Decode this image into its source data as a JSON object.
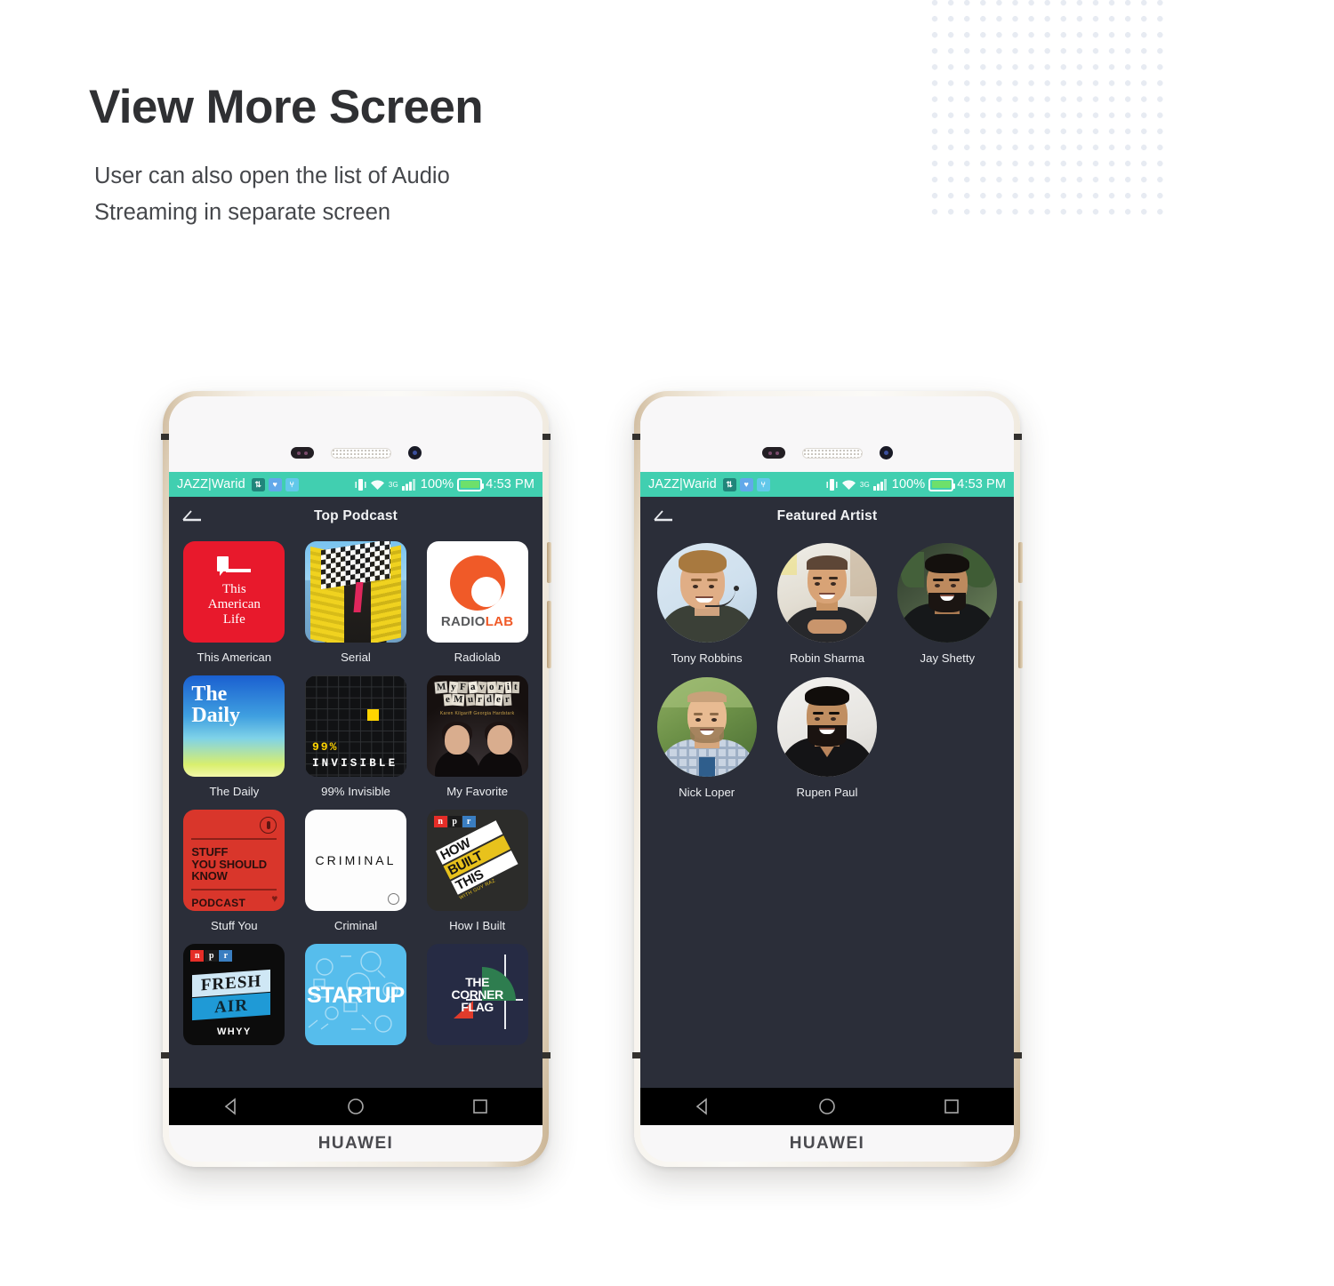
{
  "header": {
    "title": "View More Screen",
    "description": "User can also open the list of Audio\nStreaming in separate screen"
  },
  "colors": {
    "status_bar": "#41cfb0",
    "screen_bg": "#2b2e39",
    "tile_bg": "#333741",
    "text": "#eceef1",
    "dot_pattern": "#e7ebf2",
    "phone_frame": "#e8dcc8"
  },
  "status_bar": {
    "carrier": "JAZZ|Warid",
    "icons": [
      "data-transfer-icon",
      "app-icon",
      "usb-icon",
      "vibrate-icon",
      "wifi-icon",
      "3g-signal-icon"
    ],
    "network": "3G",
    "battery_percent": "100%",
    "time": "4:53 PM"
  },
  "nav_bar": {
    "back": "back-triangle-icon",
    "home": "home-circle-icon",
    "recents": "recents-square-icon"
  },
  "device": {
    "brand": "HUAWEI"
  },
  "phones": [
    {
      "id": "phone-top-podcast",
      "appbar": {
        "back_icon": "back-arrow-icon",
        "title": "Top Podcast"
      },
      "grid_type": "podcast",
      "items": [
        {
          "label": "This American",
          "art": "this-american-life",
          "art_text_1": "This",
          "art_text_2": "American",
          "art_text_3": "Life"
        },
        {
          "label": "Serial",
          "art": "serial"
        },
        {
          "label": "Radiolab",
          "art": "radiolab",
          "art_text_1": "RADIO",
          "art_text_2": "LAB"
        },
        {
          "label": "The Daily",
          "art": "the-daily",
          "art_text_1": "The",
          "art_text_2": "Daily"
        },
        {
          "label": "99% Invisible",
          "art": "99-invisible",
          "art_text_1": "99%",
          "art_text_2": "INVISIBLE"
        },
        {
          "label": "My Favorite",
          "art": "my-favorite-murder",
          "art_text_1": "My Favorite",
          "art_text_2": "Murder",
          "art_text_3": "Karen Kilgariff  Georgia Hardstark"
        },
        {
          "label": "Stuff You",
          "art": "stuff-you-should-know",
          "art_text_1": "STUFF",
          "art_text_2": "YOU SHOULD",
          "art_text_3": "KNOW",
          "art_text_4": "PODCAST"
        },
        {
          "label": "Criminal",
          "art": "criminal",
          "art_text_1": "CRIMINAL"
        },
        {
          "label": "How I Built",
          "art": "how-i-built-this",
          "art_text_1": "HOW",
          "art_text_2": "BUILT",
          "art_text_3": "THIS",
          "art_text_4": "WITH GUY RAZ",
          "npr": "npr"
        },
        {
          "label": "",
          "art": "fresh-air",
          "art_text_1": "FRESH",
          "art_text_2": "AIR",
          "art_text_3": "WHYY",
          "npr": "npr"
        },
        {
          "label": "",
          "art": "startup",
          "art_text_1": "STARTUP"
        },
        {
          "label": "",
          "art": "the-corner-flag",
          "art_text_1": "THE",
          "art_text_2": "CORNER",
          "art_text_3": "FLAG"
        }
      ]
    },
    {
      "id": "phone-featured-artist",
      "appbar": {
        "back_icon": "back-arrow-icon",
        "title": "Featured Artist"
      },
      "grid_type": "artist",
      "items": [
        {
          "label": "Tony Robbins",
          "avatar": "tony-robbins"
        },
        {
          "label": "Robin Sharma",
          "avatar": "robin-sharma"
        },
        {
          "label": "Jay Shetty",
          "avatar": "jay-shetty"
        },
        {
          "label": "Nick Loper",
          "avatar": "nick-loper"
        },
        {
          "label": "Rupen Paul",
          "avatar": "rupen-paul"
        }
      ]
    }
  ]
}
